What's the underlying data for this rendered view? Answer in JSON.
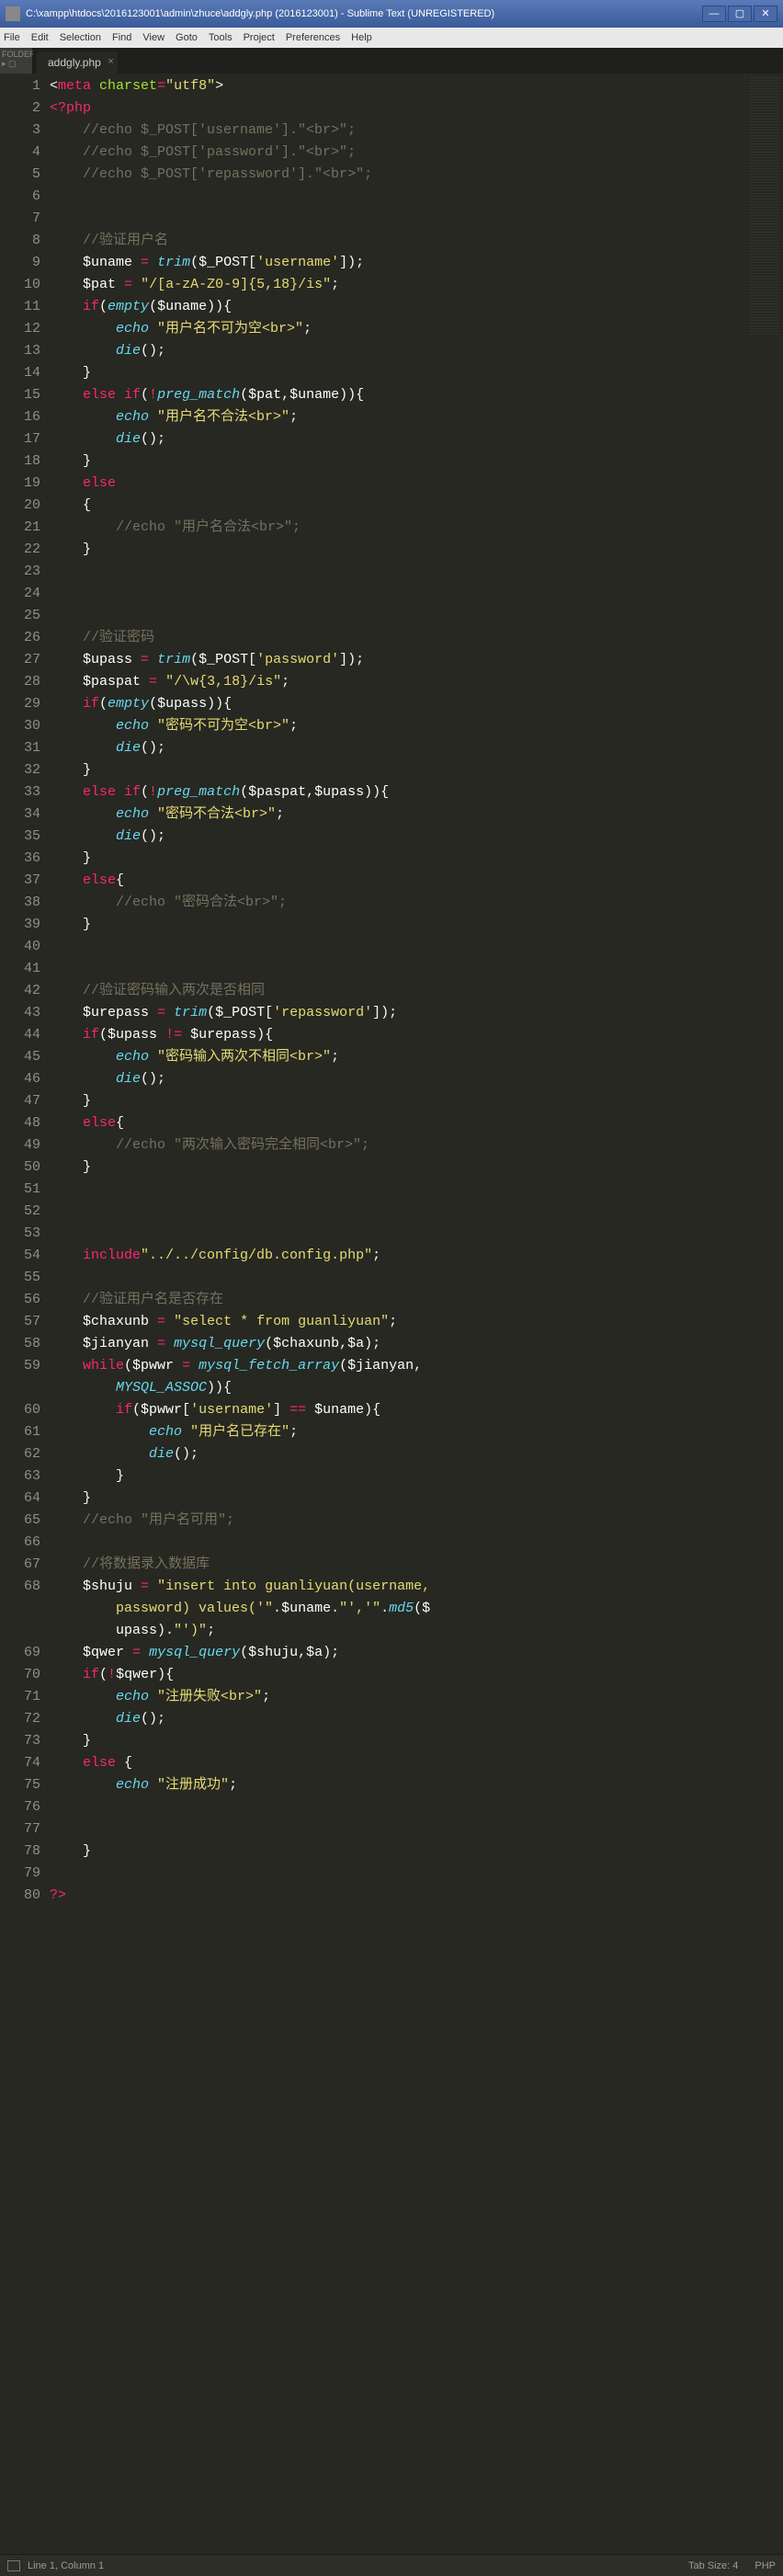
{
  "window": {
    "title": "C:\\xampp\\htdocs\\2016123001\\admin\\zhuce\\addgly.php (2016123001) - Sublime Text (UNREGISTERED)"
  },
  "menu": [
    "File",
    "Edit",
    "Selection",
    "Find",
    "View",
    "Goto",
    "Tools",
    "Project",
    "Preferences",
    "Help"
  ],
  "sidebar": {
    "label": "FOLDER",
    "arrow": "▸ ▢"
  },
  "tab": {
    "name": "addgly.php"
  },
  "status": {
    "left": "Line 1, Column 1",
    "tabsize": "Tab Size: 4",
    "lang": "PHP"
  },
  "lines": [
    {
      "n": "1",
      "html": "<span class='p'>&lt;</span><span class='kw'>meta</span> <span class='nm'>charset</span><span class='op'>=</span><span class='st'>\"utf8\"</span><span class='p'>&gt;</span>"
    },
    {
      "n": "2",
      "html": "<span class='kw'>&lt;?php</span>"
    },
    {
      "n": "3",
      "html": "    <span class='cm'>//echo $_POST['username'].\"&lt;br&gt;\";</span>"
    },
    {
      "n": "4",
      "html": "    <span class='cm'>//echo $_POST['password'].\"&lt;br&gt;\";</span>"
    },
    {
      "n": "5",
      "html": "    <span class='cm'>//echo $_POST['repassword'].\"&lt;br&gt;\";</span>"
    },
    {
      "n": "6",
      "html": ""
    },
    {
      "n": "7",
      "html": ""
    },
    {
      "n": "8",
      "html": "    <span class='cm'>//验证用户名</span>"
    },
    {
      "n": "9",
      "html": "    <span class='va'>$uname</span> <span class='op'>=</span> <span class='fn'>trim</span><span class='p'>(</span><span class='va'>$_POST</span><span class='p'>[</span><span class='st'>'username'</span><span class='p'>]);</span>"
    },
    {
      "n": "10",
      "html": "    <span class='va'>$pat</span> <span class='op'>=</span> <span class='st'>\"/[a-zA-Z0-9]{5,18}/is\"</span><span class='p'>;</span>"
    },
    {
      "n": "11",
      "html": "    <span class='kw'>if</span><span class='p'>(</span><span class='fn'>empty</span><span class='p'>(</span><span class='va'>$uname</span><span class='p'>)){</span>"
    },
    {
      "n": "12",
      "html": "        <span class='fn'>echo</span> <span class='st'>\"用户名不可为空&lt;br&gt;\"</span><span class='p'>;</span>"
    },
    {
      "n": "13",
      "html": "        <span class='fn'>die</span><span class='p'>();</span>"
    },
    {
      "n": "14",
      "html": "    <span class='p'>}</span>"
    },
    {
      "n": "15",
      "html": "    <span class='kw'>else if</span><span class='p'>(</span><span class='op'>!</span><span class='fn'>preg_match</span><span class='p'>(</span><span class='va'>$pat</span><span class='p'>,</span><span class='va'>$uname</span><span class='p'>)){</span>"
    },
    {
      "n": "16",
      "html": "        <span class='fn'>echo</span> <span class='st'>\"用户名不合法&lt;br&gt;\"</span><span class='p'>;</span>"
    },
    {
      "n": "17",
      "html": "        <span class='fn'>die</span><span class='p'>();</span>"
    },
    {
      "n": "18",
      "html": "    <span class='p'>}</span>"
    },
    {
      "n": "19",
      "html": "    <span class='kw'>else</span>"
    },
    {
      "n": "20",
      "html": "    <span class='p'>{</span>"
    },
    {
      "n": "21",
      "html": "        <span class='cm'>//echo \"用户名合法&lt;br&gt;\";</span>"
    },
    {
      "n": "22",
      "html": "    <span class='p'>}</span>"
    },
    {
      "n": "23",
      "html": ""
    },
    {
      "n": "24",
      "html": ""
    },
    {
      "n": "25",
      "html": ""
    },
    {
      "n": "26",
      "html": "    <span class='cm'>//验证密码</span>"
    },
    {
      "n": "27",
      "html": "    <span class='va'>$upass</span> <span class='op'>=</span> <span class='fn'>trim</span><span class='p'>(</span><span class='va'>$_POST</span><span class='p'>[</span><span class='st'>'password'</span><span class='p'>]);</span>"
    },
    {
      "n": "28",
      "html": "    <span class='va'>$paspat</span> <span class='op'>=</span> <span class='st'>\"/\\w{3,18}/is\"</span><span class='p'>;</span>"
    },
    {
      "n": "29",
      "html": "    <span class='kw'>if</span><span class='p'>(</span><span class='fn'>empty</span><span class='p'>(</span><span class='va'>$upass</span><span class='p'>)){</span>"
    },
    {
      "n": "30",
      "html": "        <span class='fn'>echo</span> <span class='st'>\"密码不可为空&lt;br&gt;\"</span><span class='p'>;</span>"
    },
    {
      "n": "31",
      "html": "        <span class='fn'>die</span><span class='p'>();</span>"
    },
    {
      "n": "32",
      "html": "    <span class='p'>}</span>"
    },
    {
      "n": "33",
      "html": "    <span class='kw'>else if</span><span class='p'>(</span><span class='op'>!</span><span class='fn'>preg_match</span><span class='p'>(</span><span class='va'>$paspat</span><span class='p'>,</span><span class='va'>$upass</span><span class='p'>)){</span>"
    },
    {
      "n": "34",
      "html": "        <span class='fn'>echo</span> <span class='st'>\"密码不合法&lt;br&gt;\"</span><span class='p'>;</span>"
    },
    {
      "n": "35",
      "html": "        <span class='fn'>die</span><span class='p'>();</span>"
    },
    {
      "n": "36",
      "html": "    <span class='p'>}</span>"
    },
    {
      "n": "37",
      "html": "    <span class='kw'>else</span><span class='p'>{</span>"
    },
    {
      "n": "38",
      "html": "        <span class='cm'>//echo \"密码合法&lt;br&gt;\";</span>"
    },
    {
      "n": "39",
      "html": "    <span class='p'>}</span>"
    },
    {
      "n": "40",
      "html": ""
    },
    {
      "n": "41",
      "html": ""
    },
    {
      "n": "42",
      "html": "    <span class='cm'>//验证密码输入两次是否相同</span>"
    },
    {
      "n": "43",
      "html": "    <span class='va'>$urepass</span> <span class='op'>=</span> <span class='fn'>trim</span><span class='p'>(</span><span class='va'>$_POST</span><span class='p'>[</span><span class='st'>'repassword'</span><span class='p'>]);</span>"
    },
    {
      "n": "44",
      "html": "    <span class='kw'>if</span><span class='p'>(</span><span class='va'>$upass</span> <span class='op'>!=</span> <span class='va'>$urepass</span><span class='p'>){</span>"
    },
    {
      "n": "45",
      "html": "        <span class='fn'>echo</span> <span class='st'>\"密码输入两次不相同&lt;br&gt;\"</span><span class='p'>;</span>"
    },
    {
      "n": "46",
      "html": "        <span class='fn'>die</span><span class='p'>();</span>"
    },
    {
      "n": "47",
      "html": "    <span class='p'>}</span>"
    },
    {
      "n": "48",
      "html": "    <span class='kw'>else</span><span class='p'>{</span>"
    },
    {
      "n": "49",
      "html": "        <span class='cm'>//echo \"两次输入密码完全相同&lt;br&gt;\";</span>"
    },
    {
      "n": "50",
      "html": "    <span class='p'>}</span>"
    },
    {
      "n": "51",
      "html": ""
    },
    {
      "n": "52",
      "html": ""
    },
    {
      "n": "53",
      "html": ""
    },
    {
      "n": "54",
      "html": "    <span class='kw'>include</span><span class='st'>\"../../config/db.config.php\"</span><span class='p'>;</span>"
    },
    {
      "n": "55",
      "html": ""
    },
    {
      "n": "56",
      "html": "    <span class='cm'>//验证用户名是否存在</span>"
    },
    {
      "n": "57",
      "html": "    <span class='va'>$chaxunb</span> <span class='op'>=</span> <span class='st'>\"select * from guanliyuan\"</span><span class='p'>;</span>"
    },
    {
      "n": "58",
      "html": "    <span class='va'>$jianyan</span> <span class='op'>=</span> <span class='fn'>mysql_query</span><span class='p'>(</span><span class='va'>$chaxunb</span><span class='p'>,</span><span class='va'>$a</span><span class='p'>);</span>"
    },
    {
      "n": "59",
      "html": "    <span class='kw'>while</span><span class='p'>(</span><span class='va'>$pwwr</span> <span class='op'>=</span> <span class='fn'>mysql_fetch_array</span><span class='p'>(</span><span class='va'>$jianyan</span><span class='p'>,</span>"
    },
    {
      "n": "",
      "html": "        <span class='fn'>MYSQL_ASSOC</span><span class='p'>)){</span>",
      "wrap": true
    },
    {
      "n": "60",
      "html": "        <span class='kw'>if</span><span class='p'>(</span><span class='va'>$pwwr</span><span class='p'>[</span><span class='st'>'username'</span><span class='p'>]</span> <span class='op'>==</span> <span class='va'>$uname</span><span class='p'>){</span>"
    },
    {
      "n": "61",
      "html": "            <span class='fn'>echo</span> <span class='st'>\"用户名已存在\"</span><span class='p'>;</span>"
    },
    {
      "n": "62",
      "html": "            <span class='fn'>die</span><span class='p'>();</span>"
    },
    {
      "n": "63",
      "html": "        <span class='p'>}</span>"
    },
    {
      "n": "64",
      "html": "    <span class='p'>}</span>"
    },
    {
      "n": "65",
      "html": "    <span class='cm'>//echo \"用户名可用\";</span>"
    },
    {
      "n": "66",
      "html": ""
    },
    {
      "n": "67",
      "html": "    <span class='cm'>//将数据录入数据库</span>"
    },
    {
      "n": "68",
      "html": "    <span class='va'>$shuju</span> <span class='op'>=</span> <span class='st'>\"insert into guanliyuan(username,</span>"
    },
    {
      "n": "",
      "html": "        <span class='st'>password) values('\"</span><span class='p'>.</span><span class='va'>$uname</span><span class='p'>.</span><span class='st'>\"','\"</span><span class='p'>.</span><span class='fn'>md5</span><span class='p'>(</span><span class='va'>$</span>",
      "wrap": true
    },
    {
      "n": "",
      "html": "        <span class='va'>upass</span><span class='p'>).</span><span class='st'>\"')\"</span><span class='p'>;</span>",
      "wrap": true
    },
    {
      "n": "69",
      "html": "    <span class='va'>$qwer</span> <span class='op'>=</span> <span class='fn'>mysql_query</span><span class='p'>(</span><span class='va'>$shuju</span><span class='p'>,</span><span class='va'>$a</span><span class='p'>);</span>"
    },
    {
      "n": "70",
      "html": "    <span class='kw'>if</span><span class='p'>(</span><span class='op'>!</span><span class='va'>$qwer</span><span class='p'>){</span>"
    },
    {
      "n": "71",
      "html": "        <span class='fn'>echo</span> <span class='st'>\"注册失败&lt;br&gt;\"</span><span class='p'>;</span>"
    },
    {
      "n": "72",
      "html": "        <span class='fn'>die</span><span class='p'>();</span>"
    },
    {
      "n": "73",
      "html": "    <span class='p'>}</span>"
    },
    {
      "n": "74",
      "html": "    <span class='kw'>else</span> <span class='p'>{</span>"
    },
    {
      "n": "75",
      "html": "        <span class='fn'>echo</span> <span class='st'>\"注册成功\"</span><span class='p'>;</span>"
    },
    {
      "n": "76",
      "html": ""
    },
    {
      "n": "77",
      "html": ""
    },
    {
      "n": "78",
      "html": "    <span class='p'>}</span>"
    },
    {
      "n": "79",
      "html": ""
    },
    {
      "n": "80",
      "html": "<span class='kw'>?&gt;</span>"
    }
  ]
}
